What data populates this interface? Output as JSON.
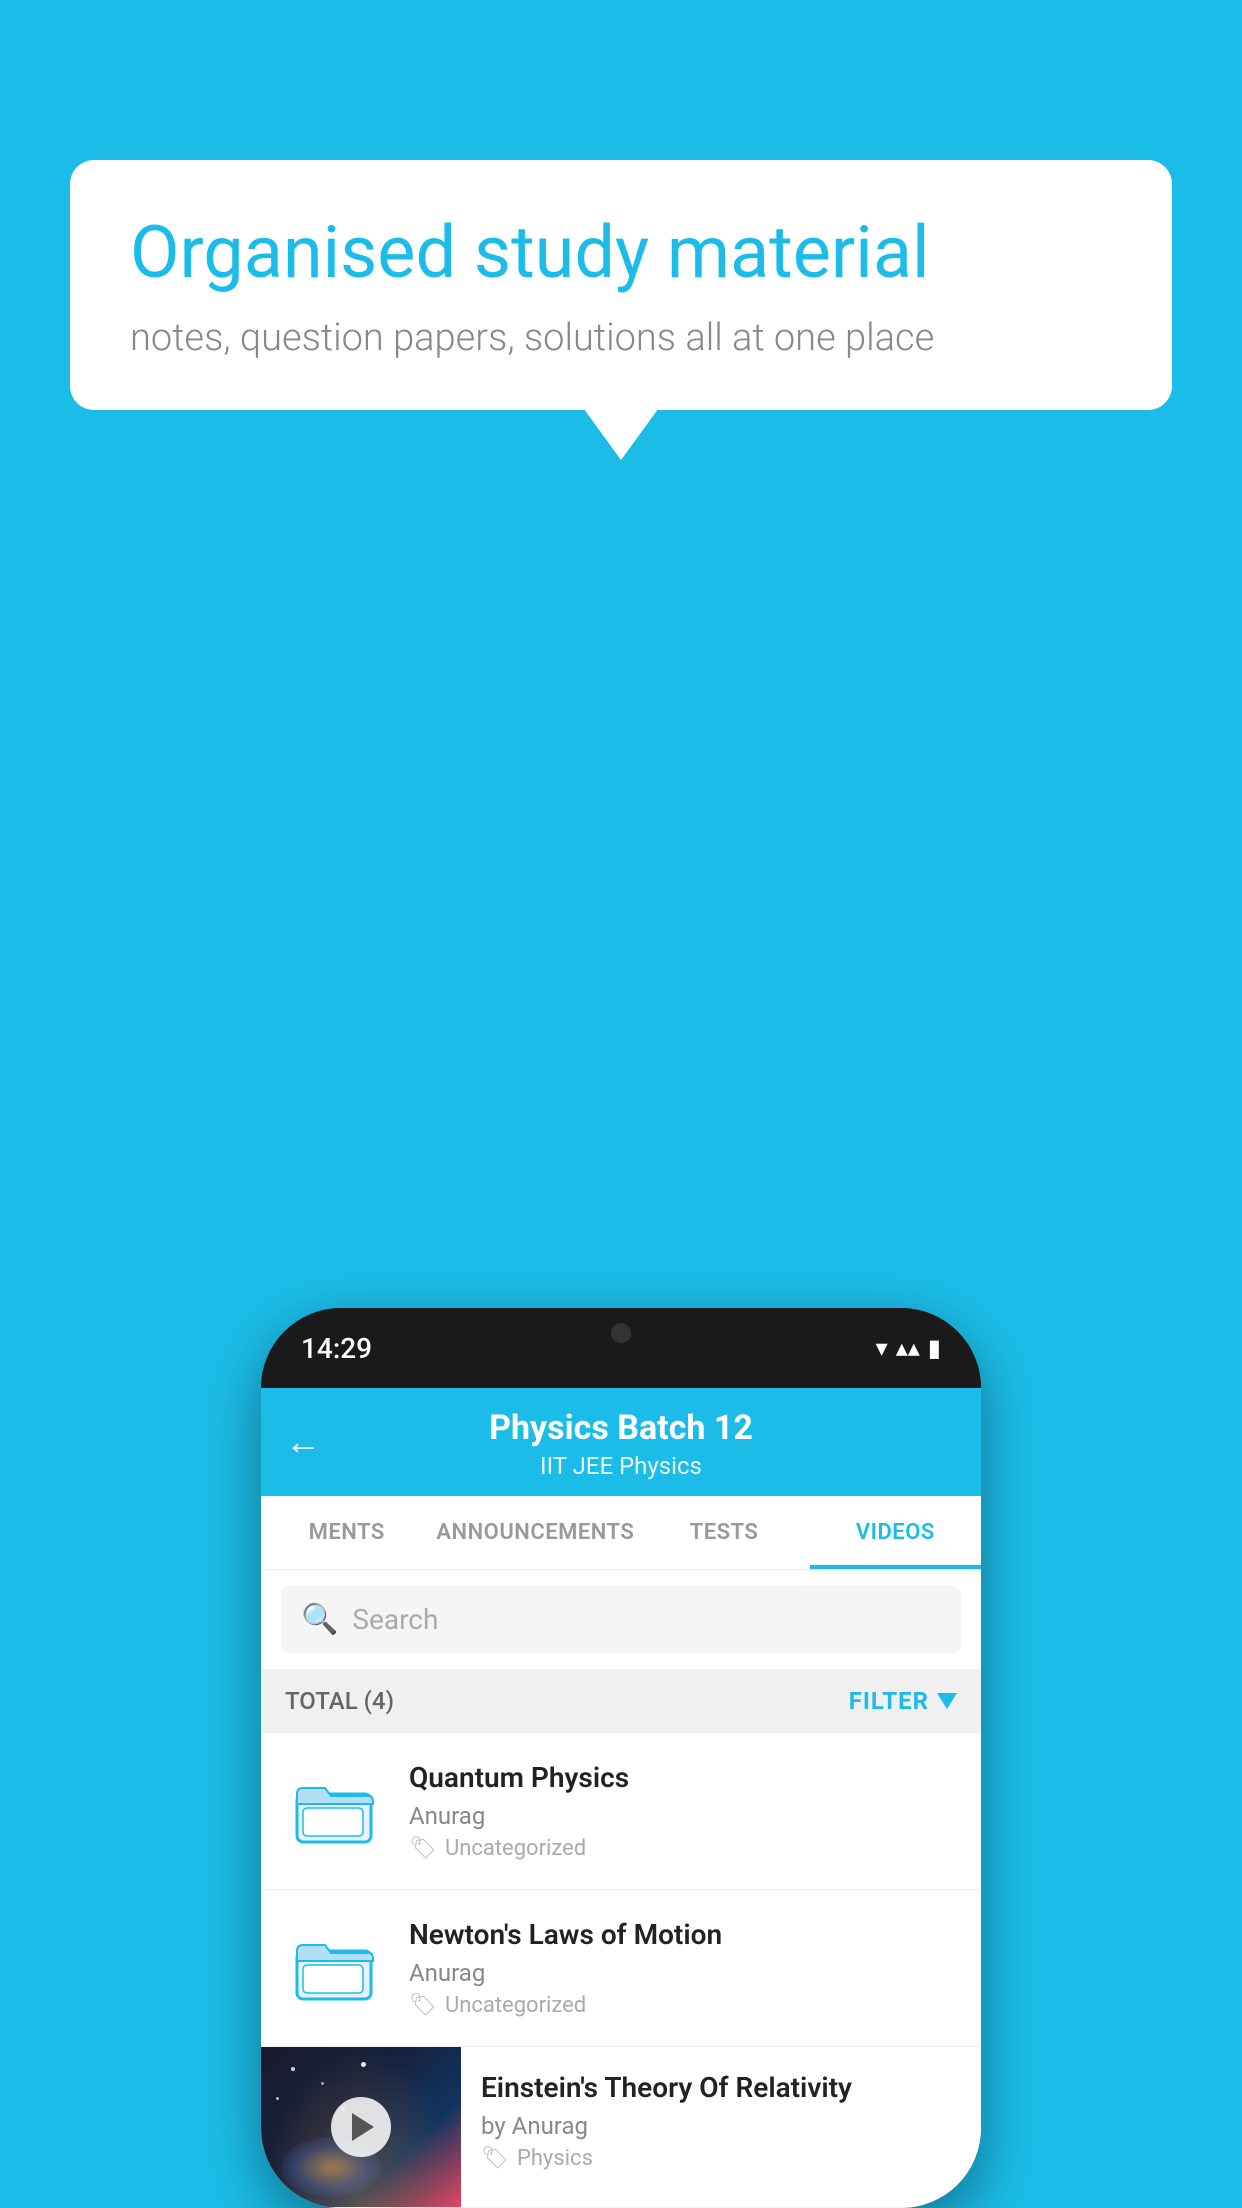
{
  "background": {
    "color": "#1BBDE8"
  },
  "speech_bubble": {
    "title": "Organised study material",
    "subtitle": "notes, question papers, solutions all at one place"
  },
  "phone": {
    "status_bar": {
      "time": "14:29"
    },
    "header": {
      "title": "Physics Batch 12",
      "subtitle": "IIT JEE   Physics",
      "back_label": "←"
    },
    "tabs": [
      {
        "label": "MENTS",
        "active": false
      },
      {
        "label": "ANNOUNCEMENTS",
        "active": false
      },
      {
        "label": "TESTS",
        "active": false
      },
      {
        "label": "VIDEOS",
        "active": true
      }
    ],
    "search": {
      "placeholder": "Search"
    },
    "filter_row": {
      "total_label": "TOTAL (4)",
      "filter_label": "FILTER"
    },
    "videos": [
      {
        "id": 1,
        "title": "Quantum Physics",
        "author": "Anurag",
        "tag": "Uncategorized",
        "type": "folder"
      },
      {
        "id": 2,
        "title": "Newton's Laws of Motion",
        "author": "Anurag",
        "tag": "Uncategorized",
        "type": "folder"
      },
      {
        "id": 3,
        "title": "Einstein's Theory Of Relativity",
        "author": "by Anurag",
        "tag": "Physics",
        "type": "video"
      }
    ]
  }
}
